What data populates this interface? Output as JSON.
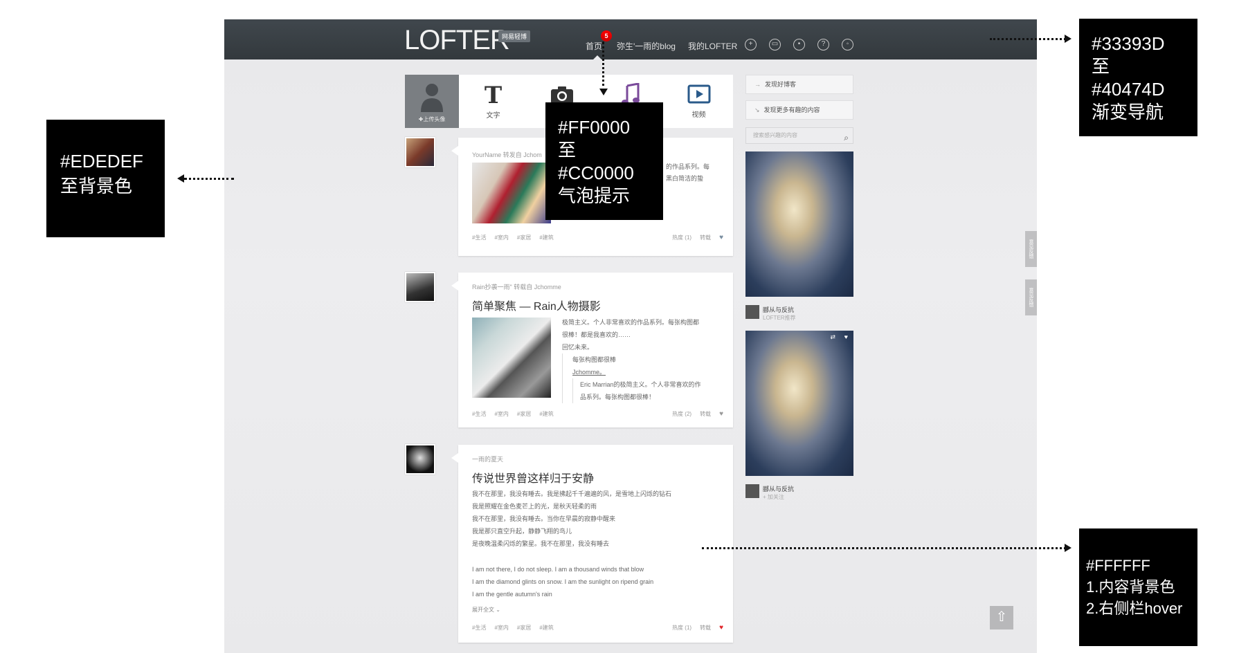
{
  "header": {
    "logo": "LOFTER",
    "logo_badge": "网易轻博",
    "notification_count": "5",
    "nav": [
      "首页",
      "弥生'一雨的blog",
      "我的LOFTER"
    ],
    "icons": [
      "add-icon",
      "message-icon",
      "settings-icon",
      "help-icon",
      "power-icon"
    ]
  },
  "publish": {
    "avatar_label": "✚上传头像",
    "buttons": [
      {
        "icon": "T",
        "label": "文字"
      },
      {
        "icon": "camera-icon",
        "label": ""
      },
      {
        "icon": "music-icon",
        "label": ""
      },
      {
        "icon": "video-icon",
        "label": "视频"
      }
    ]
  },
  "posts": [
    {
      "meta": "YourName 转发自 Jchom",
      "body_lines": [
        "的作品系列。每",
        "黑白简洁的蛰"
      ],
      "tags": [
        "#生活",
        "#室内",
        "#家居",
        "#建筑"
      ],
      "actions": [
        "热度 (1)",
        "转载"
      ],
      "liked": false
    },
    {
      "meta": "Rain抄袭一雨\" 转载自 Jchomme",
      "title": "简单聚焦 — Rain人物摄影",
      "body_lines": [
        "极简主义。个人非常喜欢的作品系列。每张构图都",
        "很棒！都是我喜欢的……",
        "回忆未来。",
        "每张构图都很棒",
        "Jchomme。",
        "Eric Marrian的极简主义。个人非常喜欢的作",
        "品系列。每张构图都很棒！"
      ],
      "tags": [
        "#生活",
        "#室内",
        "#家居",
        "#建筑"
      ],
      "actions": [
        "热度 (2)",
        "转载"
      ],
      "liked": false
    },
    {
      "meta": "一雨的夏天",
      "title": "传说世界曾这样归于安静",
      "body_lines": [
        "我不在那里，我没有睡去。我是拂起千千遍遍的风，是雪地上闪烁的钻石",
        "我是照耀在金色麦芒上的光，是秋天轻柔的雨",
        "我不在那里，我没有睡去。当你在早晨的寂静中醒来",
        "我是那只直空升起，静静飞翔的鸟儿",
        "是夜晚温柔闪烁的繁星。我不在那里，我没有睡去"
      ],
      "body_en": [
        "I am not there, I do not sleep.  I am a thousand winds that blow",
        "I am the diamond glints on snow.  I am the sunlight on ripend grain",
        "I am the gentle autumn's rain"
      ],
      "expand": "展开全文",
      "tags": [
        "#生活",
        "#室内",
        "#家居",
        "#建筑"
      ],
      "actions": [
        "热度 (1)",
        "转载"
      ],
      "liked": true
    }
  ],
  "sidebar": {
    "links": [
      "发现好博客",
      "发现更多有趣的内容"
    ],
    "search_placeholder": "搜索感兴趣的内容",
    "cards": [
      {
        "title": "郦从与反抗",
        "sub": "LOFTER推荐"
      },
      {
        "title": "郦从与反抗",
        "sub": "+ 加关注"
      }
    ],
    "feedback": [
      "意见反馈",
      "意见反馈"
    ],
    "back_top": "⇧"
  },
  "annotations": {
    "nav": [
      "#33393D",
      "至",
      "#40474D",
      "渐变导航"
    ],
    "bg": [
      "#EDEDEF",
      "至背景色"
    ],
    "bubble": [
      "#FF0000",
      "至",
      "#CC0000",
      "气泡提示"
    ],
    "content": [
      "#FFFFFF",
      "1.内容背景色",
      "2.右侧栏hover"
    ]
  },
  "colors": {
    "nav_top": "#40474D",
    "nav_bottom": "#33393D",
    "background": "#EDEDEF",
    "bubble_top": "#FF0000",
    "bubble_bottom": "#CC0000",
    "content": "#FFFFFF"
  }
}
